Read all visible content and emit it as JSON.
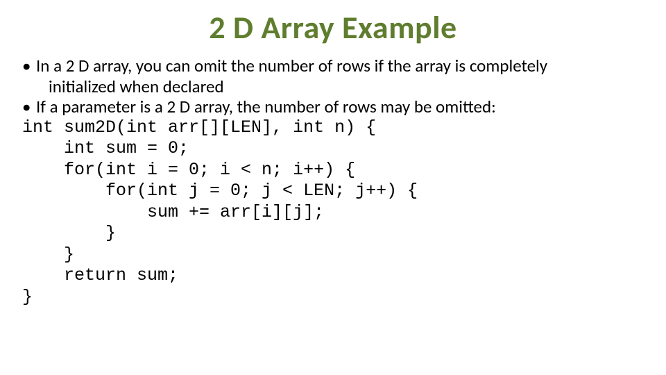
{
  "title": "2 D Array Example",
  "bullets": {
    "b1_line1": "In a 2 D array, you can omit the number of rows if the array is completely",
    "b1_line2": "initialized when declared",
    "b2": "If a parameter is a 2 D array, the number of rows may be omitted:"
  },
  "code": "int sum2D(int arr[][LEN], int n) {\n    int sum = 0;\n    for(int i = 0; i < n; i++) {\n        for(int j = 0; j < LEN; j++) {\n            sum += arr[i][j];\n        }\n    }\n    return sum;\n}"
}
